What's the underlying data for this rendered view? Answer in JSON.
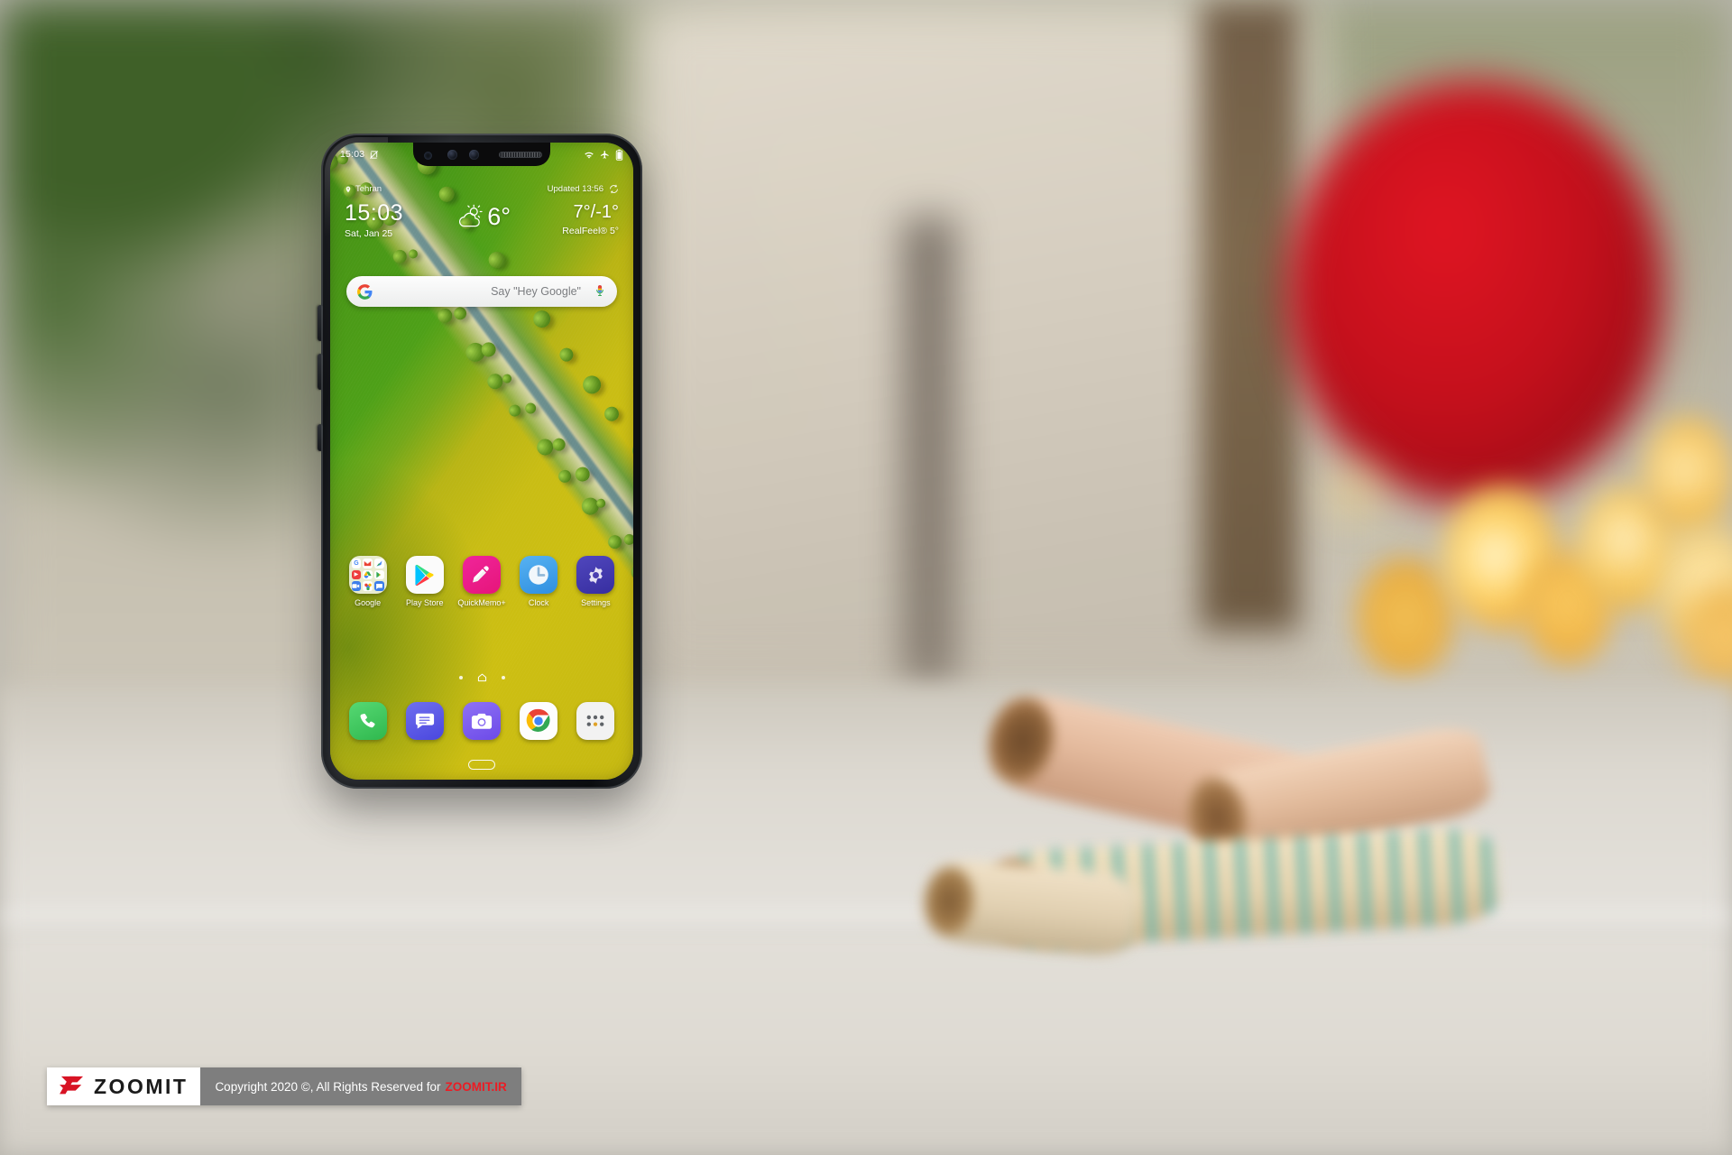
{
  "scene": {
    "description": "LG smartphone standing on a white table with blurred green foliage, red object and warm bokeh lights in the background, rolled paper scrolls to the right"
  },
  "phone": {
    "status_bar": {
      "time": "15:03",
      "left_icons": [
        "mute-icon"
      ],
      "right_icons": [
        "wifi-icon",
        "airplane-mode-icon",
        "battery-icon"
      ]
    },
    "weather_widget": {
      "location": "Tehran",
      "updated_label": "Updated 13:56",
      "refresh_icon": "refresh-icon",
      "clock_time": "15:03",
      "clock_date": "Sat, Jan 25",
      "condition_icon": "partly-cloudy-icon",
      "current_temp": "6°",
      "high_low": "7°/-1°",
      "realfeel": "RealFeel® 5°"
    },
    "search_bar": {
      "google_icon": "google-g-icon",
      "placeholder": "Say \"Hey Google\"",
      "mic_icon": "microphone-icon"
    },
    "apps": [
      {
        "label": "Google",
        "icon": "google-folder-icon"
      },
      {
        "label": "Play Store",
        "icon": "play-store-icon"
      },
      {
        "label": "QuickMemo+",
        "icon": "quickmemo-icon"
      },
      {
        "label": "Clock",
        "icon": "clock-icon"
      },
      {
        "label": "Settings",
        "icon": "settings-gear-icon"
      }
    ],
    "page_indicator": {
      "left_dot": "page-dot",
      "home_icon": "home-icon",
      "right_dot": "page-dot"
    },
    "dock": [
      {
        "label": "Phone",
        "icon": "phone-icon"
      },
      {
        "label": "Messages",
        "icon": "messages-icon"
      },
      {
        "label": "Camera",
        "icon": "camera-icon"
      },
      {
        "label": "Chrome",
        "icon": "chrome-icon"
      },
      {
        "label": "App Drawer",
        "icon": "app-drawer-icon"
      }
    ],
    "nav_pill": "home-gesture-pill"
  },
  "watermark": {
    "logo_mark": "zoomit-z-logo",
    "brand": "ZOOMIT",
    "copyright_prefix": "Copyright 2020 ©, All Rights Reserved for",
    "copyright_site": "ZOOMIT.IR"
  },
  "colors": {
    "wallpaper_green": "#4fa318",
    "wallpaper_yellow": "#c9bd14",
    "quickmemo_pink": "#ed1e79",
    "clock_blue": "#3b9ae8",
    "settings_purple": "#4338a8",
    "phone_green": "#3ec45c",
    "messages_blue": "#5b5bea",
    "camera_purple": "#7a5cf0",
    "zoomit_red": "#ec1c24",
    "watermark_gray": "#7e7e7e"
  }
}
